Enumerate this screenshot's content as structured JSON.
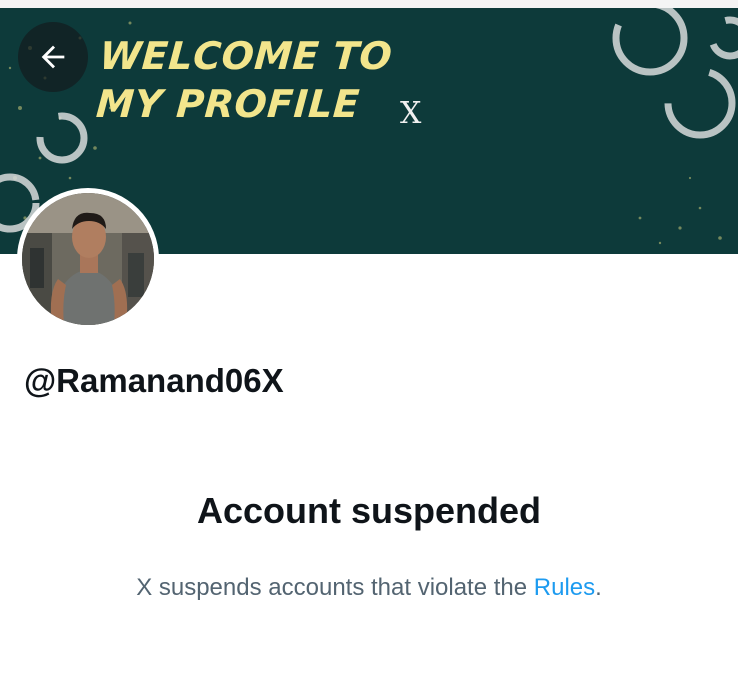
{
  "banner": {
    "title_line1": "WELCOME TO",
    "title_line2": "MY PROFILE",
    "x_glyph": "X",
    "background_color": "#0d3a3a",
    "title_color": "#f2e58c"
  },
  "back_button": {
    "icon": "arrow-left-icon"
  },
  "profile": {
    "handle": "@Ramanand06X",
    "avatar_icon": "profile-photo"
  },
  "suspension": {
    "title": "Account suspended",
    "description_prefix": "X suspends accounts that violate the ",
    "rules_link": "Rules",
    "description_suffix": ".",
    "link_color": "#1d9bf0"
  }
}
